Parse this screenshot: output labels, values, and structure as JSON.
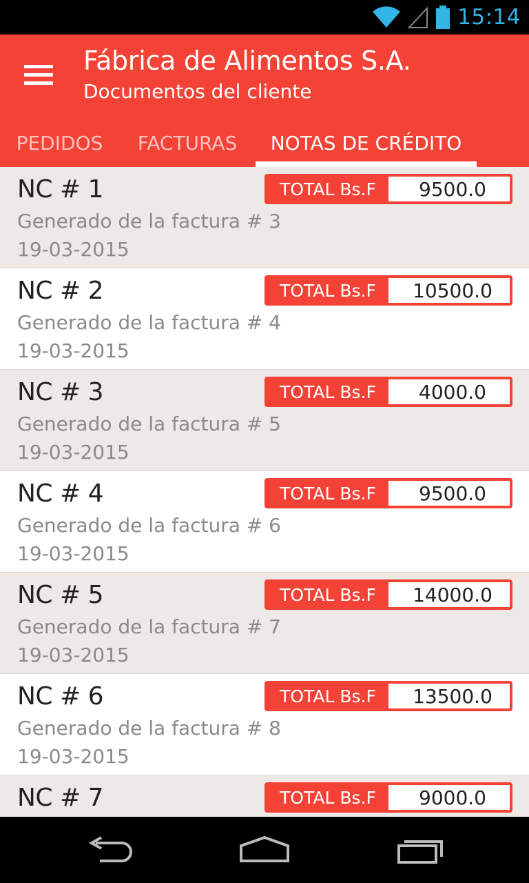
{
  "status_bar": {
    "time": "15:14",
    "icons": [
      "wifi-icon",
      "signal-icon",
      "battery-icon"
    ],
    "accent": "#33b5e5"
  },
  "app_bar": {
    "title": "Fábrica de Alimentos S.A.",
    "subtitle": "Documentos del cliente",
    "menu_icon": "hamburger-menu-icon",
    "color": "#f44336"
  },
  "tabs": [
    {
      "label": "PEDIDOS",
      "active": false
    },
    {
      "label": "FACTURAS",
      "active": false
    },
    {
      "label": "NOTAS DE CRÉDITO",
      "active": true
    }
  ],
  "credit_notes": [
    {
      "title": "NC # 1",
      "origin": "Generado de la factura # 3",
      "date": "19-03-2015",
      "total_label": "TOTAL Bs.F",
      "total": "9500.0"
    },
    {
      "title": "NC # 2",
      "origin": "Generado de la factura # 4",
      "date": "19-03-2015",
      "total_label": "TOTAL Bs.F",
      "total": "10500.0"
    },
    {
      "title": "NC # 3",
      "origin": "Generado de la factura # 5",
      "date": "19-03-2015",
      "total_label": "TOTAL Bs.F",
      "total": "4000.0"
    },
    {
      "title": "NC # 4",
      "origin": "Generado de la factura # 6",
      "date": "19-03-2015",
      "total_label": "TOTAL Bs.F",
      "total": "9500.0"
    },
    {
      "title": "NC # 5",
      "origin": "Generado de la factura # 7",
      "date": "19-03-2015",
      "total_label": "TOTAL Bs.F",
      "total": "14000.0"
    },
    {
      "title": "NC # 6",
      "origin": "Generado de la factura # 8",
      "date": "19-03-2015",
      "total_label": "TOTAL Bs.F",
      "total": "13500.0"
    },
    {
      "title": "NC # 7",
      "origin": "",
      "date": "",
      "total_label": "TOTAL Bs.F",
      "total": "9000.0"
    }
  ],
  "nav_bar": {
    "icons": [
      "back-icon",
      "home-icon",
      "recent-apps-icon"
    ]
  }
}
